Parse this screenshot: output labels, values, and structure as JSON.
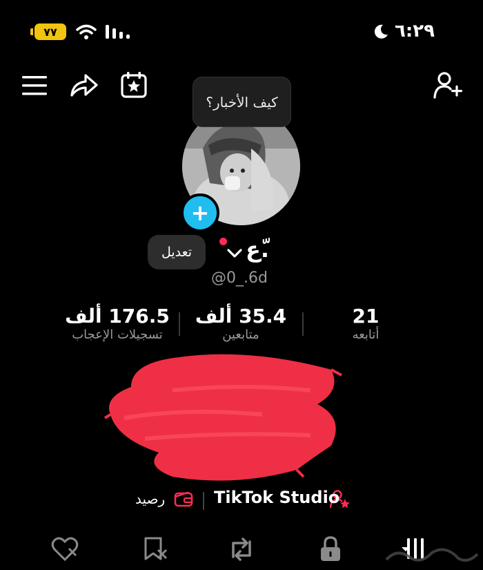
{
  "status_bar": {
    "battery": "٧٧",
    "time": "٦:٢٩"
  },
  "bubble_text": "كيف الأخبار؟",
  "profile": {
    "edit_label": "تعديل",
    "display_name": "ع.ّ",
    "handle": "@0_.6d"
  },
  "stats": [
    {
      "value": "21",
      "label": "أتابعه"
    },
    {
      "value": "35.4 ألف",
      "label": "متابعين"
    },
    {
      "value": "176.5 ألف",
      "label": "تسجيلات الإعجاب"
    }
  ],
  "links": {
    "studio": "TikTok Studio",
    "balance": "رصيد"
  },
  "colors": {
    "accent": "#fe2c55",
    "badge": "#20bdf0"
  }
}
